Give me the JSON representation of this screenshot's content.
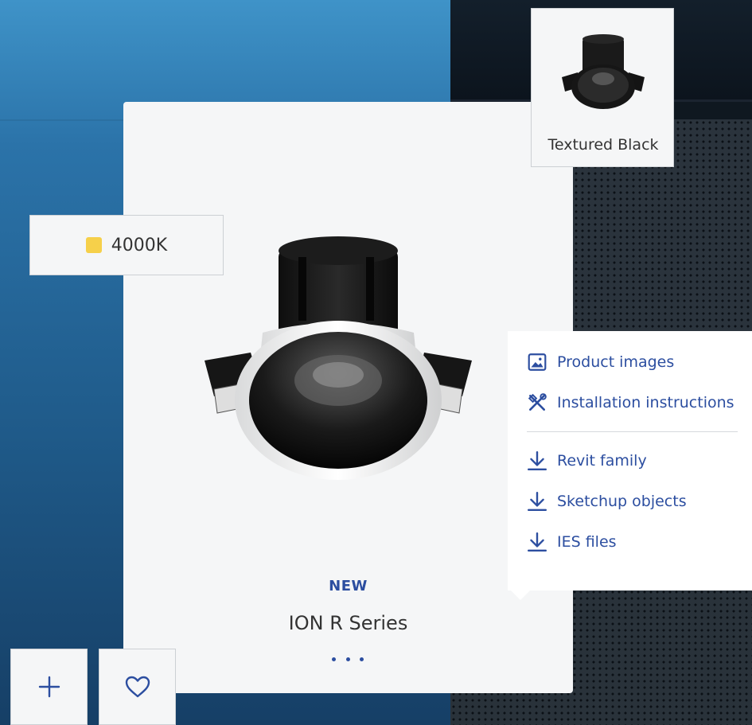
{
  "swatch": {
    "label": "Textured Black"
  },
  "color_temperature": {
    "label": "4000K",
    "color": "#f6d04a"
  },
  "resources": {
    "items": [
      {
        "label": "Product images",
        "icon": "image-icon"
      },
      {
        "label": "Installation instructions",
        "icon": "tools-icon"
      },
      {
        "label": "Revit family",
        "icon": "download-icon"
      },
      {
        "label": "Sketchup objects",
        "icon": "download-icon"
      },
      {
        "label": "IES files",
        "icon": "download-icon"
      }
    ]
  },
  "product": {
    "badge": "NEW",
    "name": "ION R Series",
    "more_icon": "ellipsis-icon"
  },
  "actions": {
    "add_icon": "plus-icon",
    "favorite_icon": "heart-icon"
  },
  "colors": {
    "accent": "#2c4ea0"
  }
}
